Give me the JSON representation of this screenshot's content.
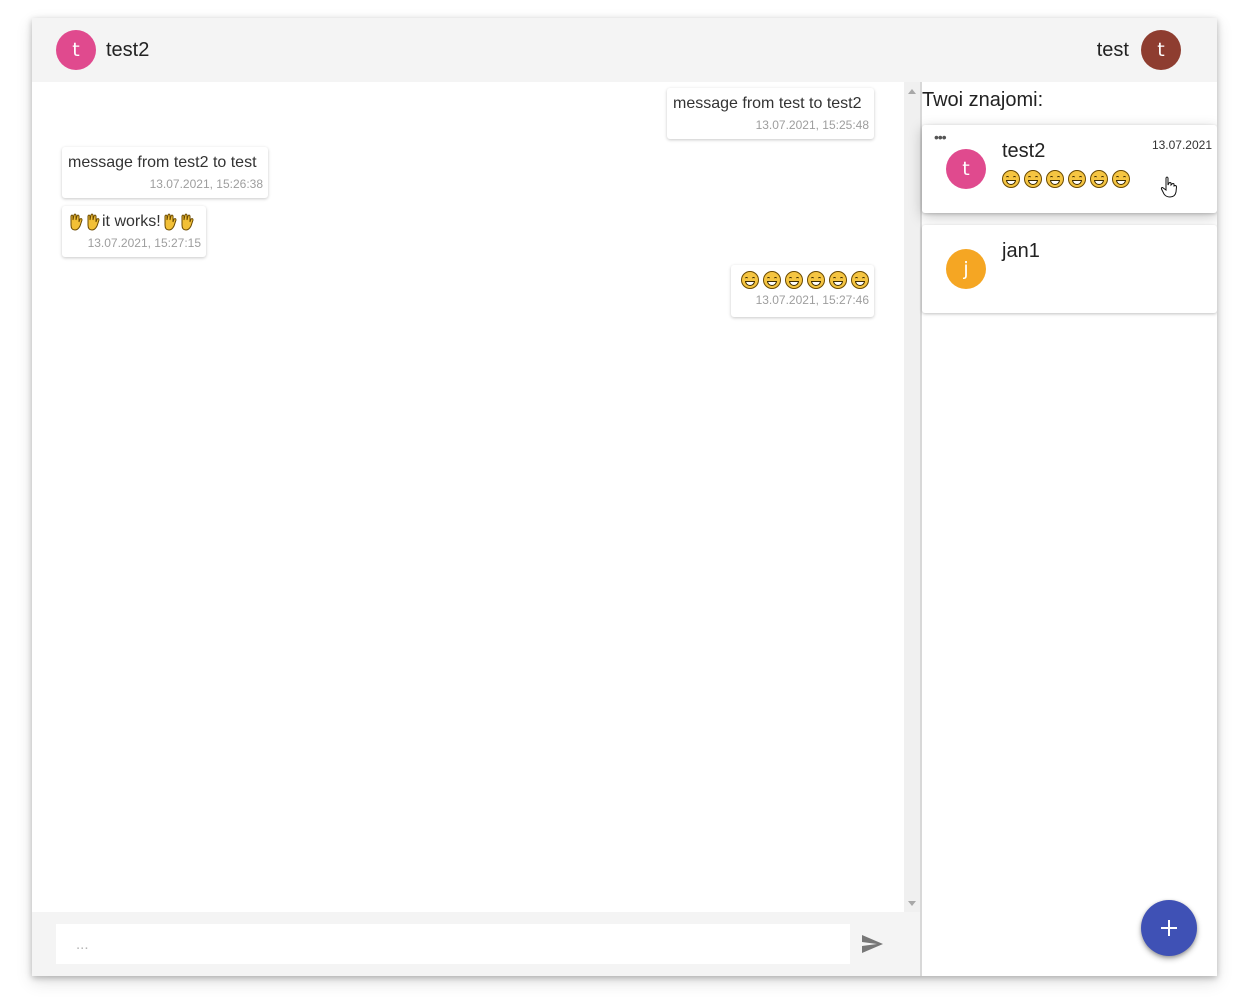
{
  "header": {
    "chat_partner": {
      "initial": "t",
      "name": "test2",
      "avatar_color": "#e04a8e"
    },
    "current_user": {
      "initial": "t",
      "name": "test",
      "avatar_color": "#8e3d30"
    }
  },
  "messages": [
    {
      "direction": "sent",
      "text": "message from test to test2",
      "time": "13.07.2021, 15:25:48"
    },
    {
      "direction": "received",
      "text": "message from test2 to test",
      "time": "13.07.2021, 15:26:38"
    },
    {
      "direction": "received",
      "text": "it works!",
      "emoji_before": [
        "hand-icon",
        "hand-icon"
      ],
      "emoji_after": [
        "hand-icon",
        "hand-icon"
      ],
      "time": "13.07.2021, 15:27:15"
    },
    {
      "direction": "sent",
      "emoji": [
        "grinning-face-icon",
        "grinning-face-icon",
        "grinning-face-icon",
        "grinning-face-icon",
        "grinning-face-icon",
        "grinning-face-icon"
      ],
      "time": "13.07.2021, 15:27:46"
    }
  ],
  "composer": {
    "placeholder": "...",
    "send_icon": "send-icon"
  },
  "friends": {
    "title": "Twoi znajomi:",
    "items": [
      {
        "initial": "t",
        "name": "test2",
        "date": "13.07.2021",
        "avatar_color": "#e04a8e",
        "last_message_emoji": [
          "grinning-face-icon",
          "grinning-face-icon",
          "grinning-face-icon",
          "grinning-face-icon",
          "grinning-face-icon",
          "grinning-face-icon"
        ],
        "menu_label": "•••"
      },
      {
        "initial": "j",
        "name": "jan1",
        "date": "",
        "avatar_color": "#f5a623"
      }
    ]
  },
  "fab": {
    "icon": "plus-icon",
    "color": "#3f51b5"
  }
}
